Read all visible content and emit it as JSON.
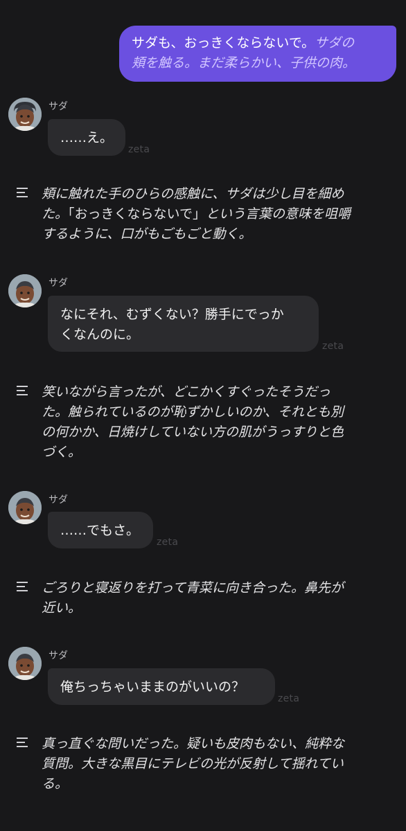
{
  "user_message": {
    "spoken": "サダも、おっきくならないで。",
    "action_line1": "サダの",
    "action_line2": "頬を触る。まだ柔らかい、子供の肉。"
  },
  "brand_tag": "zeta",
  "character": {
    "name": "サダ",
    "avatar_icon": "character-avatar-icon"
  },
  "messages": [
    {
      "text": "……え。"
    },
    {
      "text_line1": "なにそれ、むずくない？勝手にでっか",
      "text_line2": "くなんのに。"
    },
    {
      "text": "……でもさ。"
    },
    {
      "text": "俺ちっちゃいままのがいいの？"
    }
  ],
  "narrations": [
    {
      "line1": "頬に触れた手のひらの感触に、サダは少し目を細め",
      "line2_a": "た。",
      "line2_dialog": "「おっきくならないで」",
      "line2_b": "という言葉の意味を咀嚼",
      "line3": "するように、口がもごもごと動く。"
    },
    {
      "line1": "笑いながら言ったが、どこかくすぐったそうだっ",
      "line2": "た。触られているのが恥ずかしいのか、それとも別",
      "line3": "の何かか、日焼けしていない方の肌がうっすりと色",
      "line4": "づく。"
    },
    {
      "line1": "ごろりと寝返りを打って青菜に向き合った。鼻先が",
      "line2": "近い。"
    },
    {
      "line1": "真っ直ぐな問いだった。疑いも皮肉もない、純粋な",
      "line2": "質問。大きな黒目にテレビの光が反射して揺れてい",
      "line3": "る。"
    }
  ],
  "colors": {
    "background": "#18181a",
    "user_bubble": "#6b50e0",
    "char_bubble": "#2b2b2e"
  }
}
